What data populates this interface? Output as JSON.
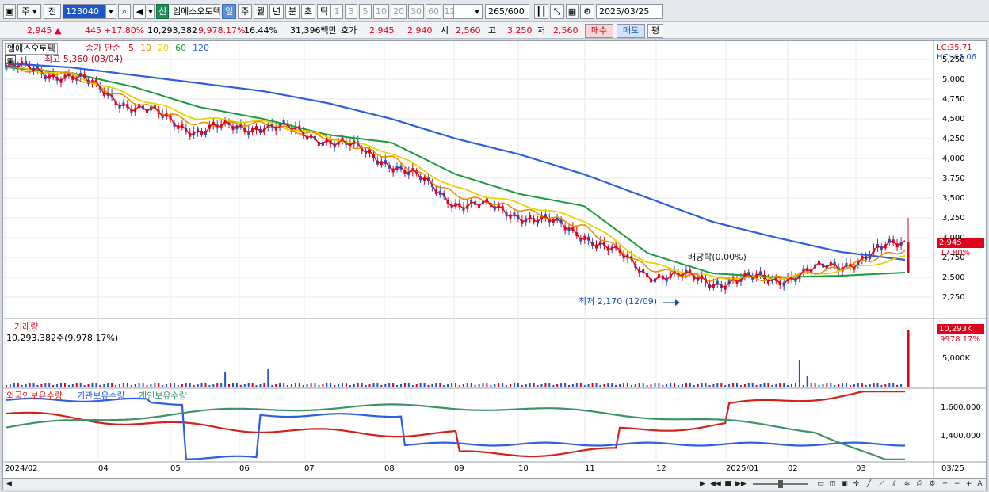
{
  "toolbar": {
    "period_label": "주",
    "prev_label": "전",
    "code": "123040",
    "new_label": "신",
    "stock_name": "엠에스오토텍",
    "intervals": [
      {
        "label": "일",
        "selected": true
      },
      {
        "label": "주",
        "selected": false
      },
      {
        "label": "월",
        "selected": false
      },
      {
        "label": "년",
        "selected": false
      },
      {
        "label": "분",
        "selected": false
      },
      {
        "label": "초",
        "selected": false
      },
      {
        "label": "틱",
        "selected": false
      }
    ],
    "minute_presets": [
      "1",
      "3",
      "5",
      "10",
      "20",
      "30",
      "60",
      "120"
    ],
    "count": "265",
    "count_max": "/600",
    "date": "2025/03/25"
  },
  "quote": {
    "price": "2,945",
    "change": "445",
    "change_pct": "+17.80%",
    "volume": "10,293,382",
    "volume_pct": "9,978.17%",
    "turnover": "16.44%",
    "amount": "31,396백만",
    "ask_label": "호가",
    "ask": "2,945",
    "bid": "2,940",
    "open_label": "시",
    "open": "2,560",
    "high_label": "고",
    "high": "3,250",
    "low_label": "저",
    "low": "2,560",
    "buy_label": "매수",
    "sell_label": "매도",
    "eval_label": "평"
  },
  "price_panel": {
    "legend_name": "엠에스오토텍",
    "legend_ma_title": "종가 단순",
    "ma_labels": [
      {
        "label": "5",
        "color": "#e3001b"
      },
      {
        "label": "10",
        "color": "#f08c00"
      },
      {
        "label": "20",
        "color": "#e6d400"
      },
      {
        "label": "60",
        "color": "#1a9a3c"
      },
      {
        "label": "120",
        "color": "#2e5fe0"
      }
    ],
    "high_note": "최고 5,360 (03/04)",
    "low_note": "최저 2,170 (12/09)",
    "dividend_note": "배당락(0.00%)",
    "lc": "LC:35.71",
    "hc": "HC:-45.06",
    "current_price_tag": "2,945",
    "current_pct_tag": "17.80%"
  },
  "volume_panel": {
    "title": "거래량",
    "value_line": "10,293,382주(9,978.17%)",
    "tag": "10,293K",
    "tag_pct": "9978.17%",
    "axis_label": "5,000K"
  },
  "holding_panel": {
    "series": [
      {
        "name": "외국인보유수량",
        "color": "#d6201b"
      },
      {
        "name": "기관보유수량",
        "color": "#2e5fe0"
      },
      {
        "name": "개인보유수량",
        "color": "#3c9466"
      }
    ],
    "axis_labels": [
      "1,600,000",
      "1,400,000"
    ]
  },
  "price_axis": [
    "5,250",
    "5,000",
    "4,750",
    "4,500",
    "4,250",
    "4,000",
    "3,750",
    "3,500",
    "3,250",
    "3,000",
    "2,750",
    "2,500",
    "2,250"
  ],
  "date_axis": [
    "2024/02",
    "04",
    "05",
    "06",
    "07",
    "08",
    "09",
    "10",
    "11",
    "12",
    "2025/01",
    "02",
    "03",
    "03/25"
  ],
  "chart_data": {
    "type": "line",
    "title": "",
    "xlabel": "",
    "ylabel": "",
    "ylim": [
      2170,
      5360
    ],
    "x": [
      "2024/02",
      "03",
      "04",
      "05",
      "06",
      "07",
      "08",
      "09",
      "10",
      "11",
      "12",
      "2025/01",
      "02",
      "03",
      "03/25"
    ],
    "series": [
      {
        "name": "5",
        "values": [
          5150,
          5050,
          4650,
          4350,
          4420,
          4250,
          3950,
          3450,
          3300,
          3050,
          2550,
          2450,
          2480,
          2650,
          2945
        ]
      },
      {
        "name": "60",
        "values": [
          5150,
          5080,
          4900,
          4650,
          4500,
          4300,
          4200,
          3800,
          3550,
          3400,
          2800,
          2550,
          2500,
          2520,
          2560
        ]
      },
      {
        "name": "120",
        "values": [
          5200,
          5150,
          5050,
          4950,
          4850,
          4700,
          4500,
          4250,
          4050,
          3800,
          3500,
          3200,
          3000,
          2820,
          2720
        ]
      }
    ]
  }
}
